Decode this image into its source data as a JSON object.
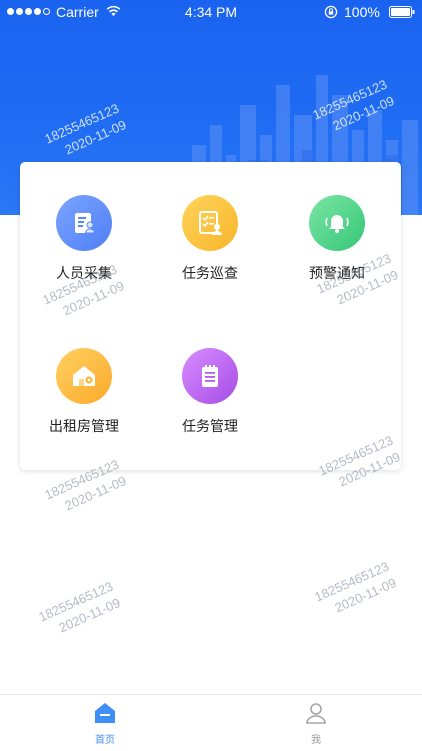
{
  "status_bar": {
    "carrier": "Carrier",
    "time": "4:34 PM",
    "battery": "100%"
  },
  "menu": {
    "items": [
      {
        "label": "人员采集",
        "icon": "person-id-card-icon",
        "color_from": "#7ba4ff",
        "color_to": "#4f7ff5"
      },
      {
        "label": "任务巡查",
        "icon": "task-inspection-icon",
        "color_from": "#ffd45a",
        "color_to": "#f7b52b"
      },
      {
        "label": "预警通知",
        "icon": "alarm-bell-icon",
        "color_from": "#7be6a4",
        "color_to": "#35c677"
      },
      {
        "label": "出租房管理",
        "icon": "rental-house-icon",
        "color_from": "#ffd161",
        "color_to": "#fba92a"
      },
      {
        "label": "任务管理",
        "icon": "task-list-icon",
        "color_from": "#d88cff",
        "color_to": "#a64de6"
      }
    ]
  },
  "watermark": {
    "phone": "18255465123",
    "date": "2020-11-09"
  },
  "tabbar": {
    "tabs": [
      {
        "label": "首页",
        "icon": "home-icon",
        "active": true
      },
      {
        "label": "我",
        "icon": "person-icon",
        "active": false
      }
    ],
    "active_color": "#3f8ff7",
    "inactive_color": "#9a9a9a"
  }
}
